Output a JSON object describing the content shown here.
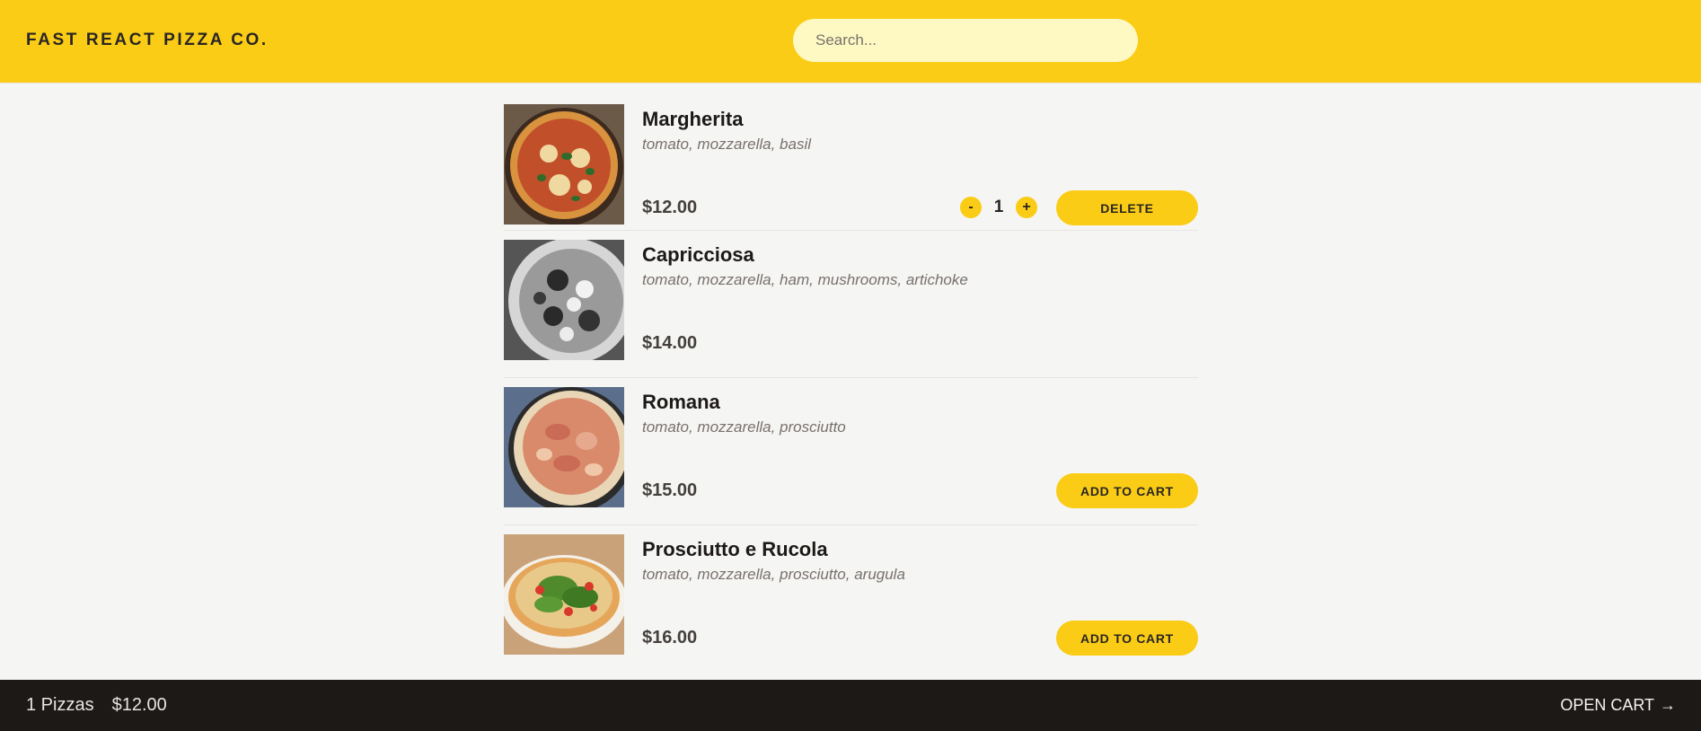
{
  "header": {
    "logo": "Fast React Pizza Co.",
    "search_placeholder": "Search..."
  },
  "menu": [
    {
      "name": "Margherita",
      "ingredients": "tomato, mozzarella, basil",
      "price": "$12.00",
      "in_cart": true,
      "quantity": "1",
      "decrease_label": "-",
      "increase_label": "+",
      "button_label": "Delete",
      "image_color": "#b3542c"
    },
    {
      "name": "Capricciosa",
      "ingredients": "tomato, mozzarella, ham, mushrooms, artichoke",
      "price": "$14.00",
      "in_cart": false,
      "sold_out": true,
      "image_color": "#8a8a8a"
    },
    {
      "name": "Romana",
      "ingredients": "tomato, mozzarella, prosciutto",
      "price": "$15.00",
      "in_cart": false,
      "button_label": "Add to cart",
      "image_color": "#c8836a"
    },
    {
      "name": "Prosciutto e Rucola",
      "ingredients": "tomato, mozzarella, prosciutto, arugula",
      "price": "$16.00",
      "in_cart": false,
      "button_label": "Add to cart",
      "image_color": "#6f9a3c"
    }
  ],
  "cart": {
    "count_label": "1 Pizzas",
    "total": "$12.00",
    "open_label": "Open cart",
    "open_arrow": "→"
  },
  "colors": {
    "accent": "#facc15",
    "search_bg": "#fef9c3",
    "footer_bg": "#1c1917",
    "page_bg": "#f5f5f4"
  }
}
